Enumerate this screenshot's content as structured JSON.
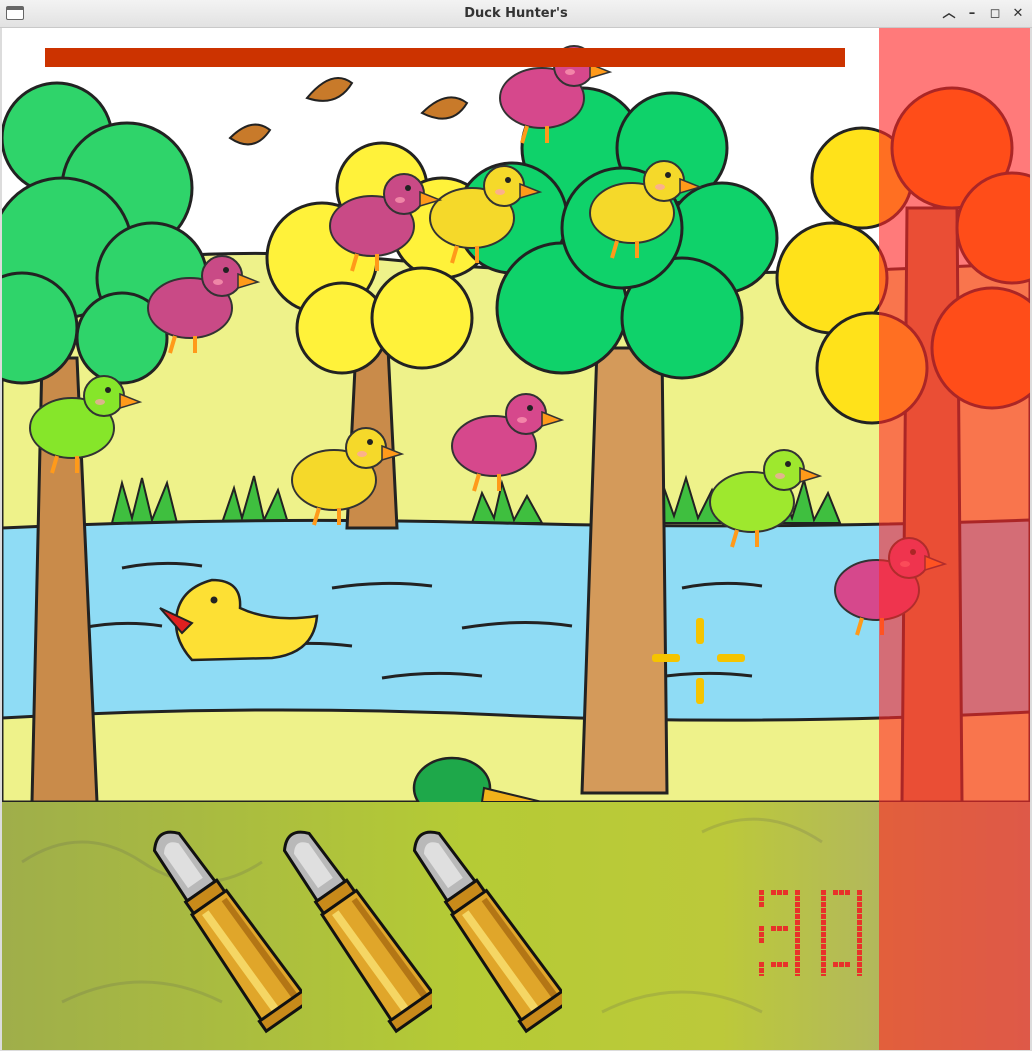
{
  "window": {
    "title": "Duck Hunter's",
    "controls": [
      "minimize",
      "restore",
      "maximize",
      "close"
    ]
  },
  "hud": {
    "bullets_remaining": 3,
    "score": "30",
    "progress_fraction": 1.0
  },
  "colors": {
    "progress_bar": "#cc3300",
    "score_dots": "#e8322a",
    "side_panel": "#ff3b3b",
    "crosshair": "#f5c400"
  },
  "ducks": [
    {
      "color": "pink",
      "type": "flying"
    },
    {
      "color": "yellow",
      "type": "flying"
    },
    {
      "color": "pink-armored",
      "type": "flying"
    },
    {
      "color": "yellow",
      "type": "flying"
    },
    {
      "color": "pink-armored",
      "type": "flying"
    },
    {
      "color": "green-armored",
      "type": "flying"
    },
    {
      "color": "pink",
      "type": "flying"
    },
    {
      "color": "yellow",
      "type": "flying"
    },
    {
      "color": "green",
      "type": "flying"
    },
    {
      "color": "pink",
      "type": "flying"
    }
  ]
}
